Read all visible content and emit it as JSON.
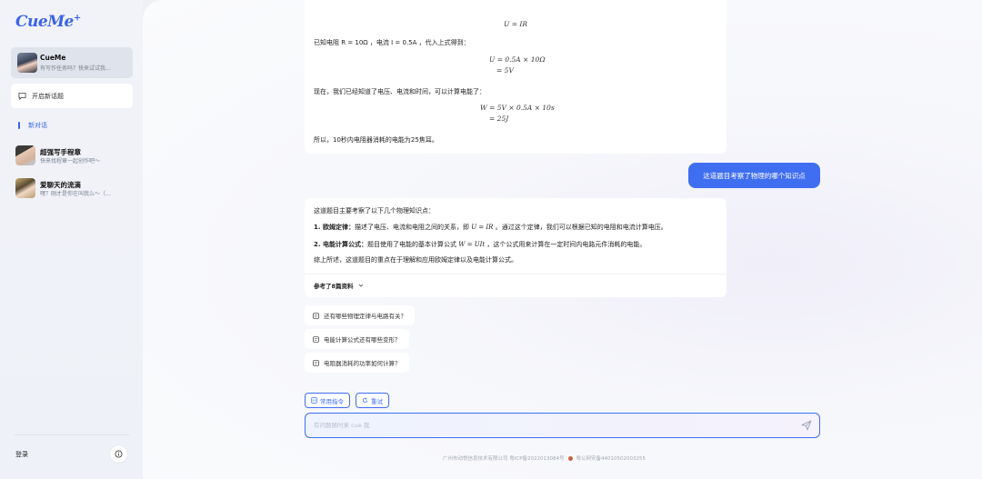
{
  "sidebar": {
    "logo": "CueMe",
    "logo_mark": "+",
    "agent": {
      "name": "CueMe",
      "desc": "有写作任务吗？快来试试我..."
    },
    "new_topic_label": "开启新话题",
    "current_conversation": "新对话",
    "bots": [
      {
        "name": "超强写手程章",
        "desc": "快来找程章一起创作吧～"
      },
      {
        "name": "爱聊天的流滴",
        "desc": "嘿？刚才是你在叫我么～（..."
      }
    ],
    "login_label": "登录"
  },
  "chat": {
    "prev_answer": {
      "formula_top": "U = IR",
      "given": "已知电阻 R = 10Ω ，电流 I = 0.5A ，代入上式得到：",
      "calc_u_1": "U = 0.5A × 10Ω",
      "calc_u_2": "= 5V",
      "now": "现在，我们已经知道了电压、电流和时间，可以计算电能了：",
      "calc_w_1": "W = 5V × 0.5A × 10s",
      "calc_w_2": "= 25J",
      "conclusion": "所以，10秒内电阻器消耗的电能为25焦耳。"
    },
    "user_message": "这道题目考察了物理的哪个知识点",
    "answer": {
      "intro": "这道题目主要考察了以下几个物理知识点：",
      "point1_title": "1. 欧姆定律：",
      "point1_text_a": "描述了电压、电流和电阻之间的关系，即 ",
      "point1_formula": "U = IR",
      "point1_text_b": " 。通过这个定律，我们可以根据已知的电阻和电流计算电压。",
      "point2_title": "2. 电能计算公式：",
      "point2_text_a": "题目使用了电能的基本计算公式 ",
      "point2_formula": "W = UIt",
      "point2_text_b": " ，这个公式用来计算在一定时间内电路元件消耗的电能。",
      "summary": "综上所述，这道题目的重点在于理解和应用欧姆定律以及电能计算公式。",
      "refs_label": "参考了8篇资料"
    },
    "suggestions": [
      "还有哪些物理定律与电路有关？",
      "电能计算公式还有哪些变形？",
      "电阻器消耗的功率如何计算？"
    ],
    "chips": {
      "commands": "常用指令",
      "retry": "重试"
    },
    "input_placeholder": "有问题随时来 cue 我",
    "footer_company": "广州市动悦信息技术有限公司 粤ICP备2022013084号",
    "footer_police": "粤公网安备44010502003255"
  },
  "colors": {
    "accent": "#3f6ef0",
    "sidebar_bg": "#f1f3f8"
  },
  "icons": [
    "chat-plus-icon",
    "info-icon",
    "chevron-down-icon",
    "suggestion-icon",
    "command-icon",
    "retry-icon",
    "send-icon"
  ]
}
